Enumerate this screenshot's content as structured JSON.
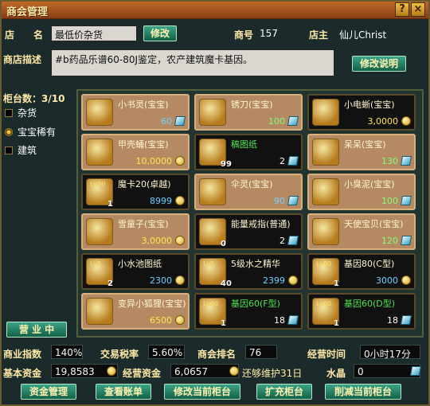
{
  "window": {
    "title": "商会管理",
    "help": "?",
    "close": "×"
  },
  "shop": {
    "name_label": "店　　名",
    "name_value": "最低价杂货",
    "modify": "修改",
    "id_label": "商号",
    "id_value": "157",
    "owner_label": "店主",
    "owner_value": "仙儿Christ",
    "desc_label": "商店描述",
    "desc_value": "#b药品乐谱60-80J鉴定，农产建筑魔卡基因。",
    "modify_desc": "修改说明"
  },
  "counters": {
    "label": "柜台数：3/10",
    "categories": [
      "杂货",
      "宝宝稀有",
      "建筑"
    ],
    "open_button": "营 业 中"
  },
  "items": [
    {
      "name": "小书灵(宝宝)",
      "price": "60",
      "currency": "crystal",
      "style": "light",
      "color": "blue",
      "name_color": "white",
      "icon": "blue-egg-icon",
      "count": "",
      "lv": ""
    },
    {
      "name": "锈刀(宝宝)",
      "price": "100",
      "currency": "crystal",
      "style": "light",
      "color": "green",
      "name_color": "white",
      "icon": "dark-egg-icon",
      "count": "",
      "lv": ""
    },
    {
      "name": "小电蜥(宝宝)",
      "price": "3,0000",
      "currency": "gold",
      "style": "dark",
      "color": "yellow",
      "name_color": "white",
      "icon": "dark-egg-icon",
      "count": "",
      "lv": ""
    },
    {
      "name": "甲壳蛹(宝宝)",
      "price": "10,0000",
      "currency": "gold",
      "style": "light",
      "color": "yellow",
      "name_color": "white",
      "icon": "green-egg-icon",
      "count": "",
      "lv": ""
    },
    {
      "name": "稿图纸",
      "price": "2",
      "currency": "crystal",
      "style": "dark",
      "color": "white",
      "name_color": "green",
      "icon": "scroll-icon",
      "count": "99",
      "lv": ""
    },
    {
      "name": "呆呆(宝宝)",
      "price": "130",
      "currency": "crystal",
      "style": "light",
      "color": "green",
      "name_color": "white",
      "icon": "yellow-egg-icon",
      "count": "",
      "lv": ""
    },
    {
      "name": "魔卡20(卓越)",
      "price": "8999",
      "currency": "gold",
      "style": "dark",
      "color": "blue",
      "name_color": "white",
      "icon": "magic-card-icon",
      "count": "1",
      "lv": "Lv20"
    },
    {
      "name": "伞灵(宝宝)",
      "price": "90",
      "currency": "crystal",
      "style": "light",
      "color": "blue",
      "name_color": "white",
      "icon": "teal-egg-icon",
      "count": "",
      "lv": ""
    },
    {
      "name": "小臭泥(宝宝)",
      "price": "100",
      "currency": "crystal",
      "style": "light",
      "color": "green",
      "name_color": "white",
      "icon": "purple-egg-icon",
      "count": "",
      "lv": ""
    },
    {
      "name": "雪童子(宝宝)",
      "price": "3,0000",
      "currency": "gold",
      "style": "light",
      "color": "yellow",
      "name_color": "white",
      "icon": "purple-egg-icon",
      "count": "",
      "lv": ""
    },
    {
      "name": "能量戒指(普通)",
      "price": "2",
      "currency": "crystal",
      "style": "dark",
      "color": "white",
      "name_color": "white",
      "icon": "ring-icon",
      "count": "0",
      "lv": ""
    },
    {
      "name": "天使宝贝(宝宝)",
      "price": "120",
      "currency": "crystal",
      "style": "light",
      "color": "green",
      "name_color": "white",
      "icon": "angel-icon",
      "count": "",
      "lv": ""
    },
    {
      "name": "小水池图纸",
      "price": "2300",
      "currency": "gold",
      "style": "dark",
      "color": "blue",
      "name_color": "white",
      "icon": "pool-icon",
      "count": "2",
      "lv": "Lv1"
    },
    {
      "name": "5级水之精华",
      "price": "2399",
      "currency": "gold",
      "style": "dark",
      "color": "blue",
      "name_color": "white",
      "icon": "water-essence-icon",
      "count": "40",
      "lv": "Lv5"
    },
    {
      "name": "基因80(C型)",
      "price": "3000",
      "currency": "gold",
      "style": "dark",
      "color": "blue",
      "name_color": "white",
      "icon": "purple-gene-icon",
      "count": "1",
      "lv": "Lv80"
    },
    {
      "name": "变异小狐狸(宝宝)",
      "price": "6500",
      "currency": "gold",
      "style": "light",
      "color": "yellow",
      "name_color": "white",
      "icon": "fox-egg-icon",
      "count": "",
      "lv": ""
    },
    {
      "name": "基因60(F型)",
      "price": "18",
      "currency": "crystal",
      "style": "dark",
      "color": "white",
      "name_color": "green",
      "icon": "green-gene-icon",
      "count": "1",
      "lv": "Lv60"
    },
    {
      "name": "基因60(D型)",
      "price": "18",
      "currency": "crystal",
      "style": "dark",
      "color": "white",
      "name_color": "green",
      "icon": "green-gene-icon",
      "count": "1",
      "lv": "Lv60"
    }
  ],
  "stats": {
    "business_index_label": "商业指数",
    "business_index": "140%",
    "tax_label": "交易税率",
    "tax": "5.60%",
    "rank_label": "商会排名",
    "rank": "76",
    "time_label": "经营时间",
    "time": "0小时17分",
    "base_fund_label": "基本资金",
    "base_fund": "19,8583",
    "op_fund_label": "经营资金",
    "op_fund": "6,0657",
    "maintain": "还够维护31日",
    "crystal_label": "水晶",
    "crystal": "0"
  },
  "buttons": [
    "资金管理",
    "查看账单",
    "修改当前柜台",
    "扩充柜台",
    "削减当前柜台"
  ],
  "colors": {
    "accent": "#2a8a6a",
    "title": "#b3561e",
    "gold": "#ffe64d"
  }
}
